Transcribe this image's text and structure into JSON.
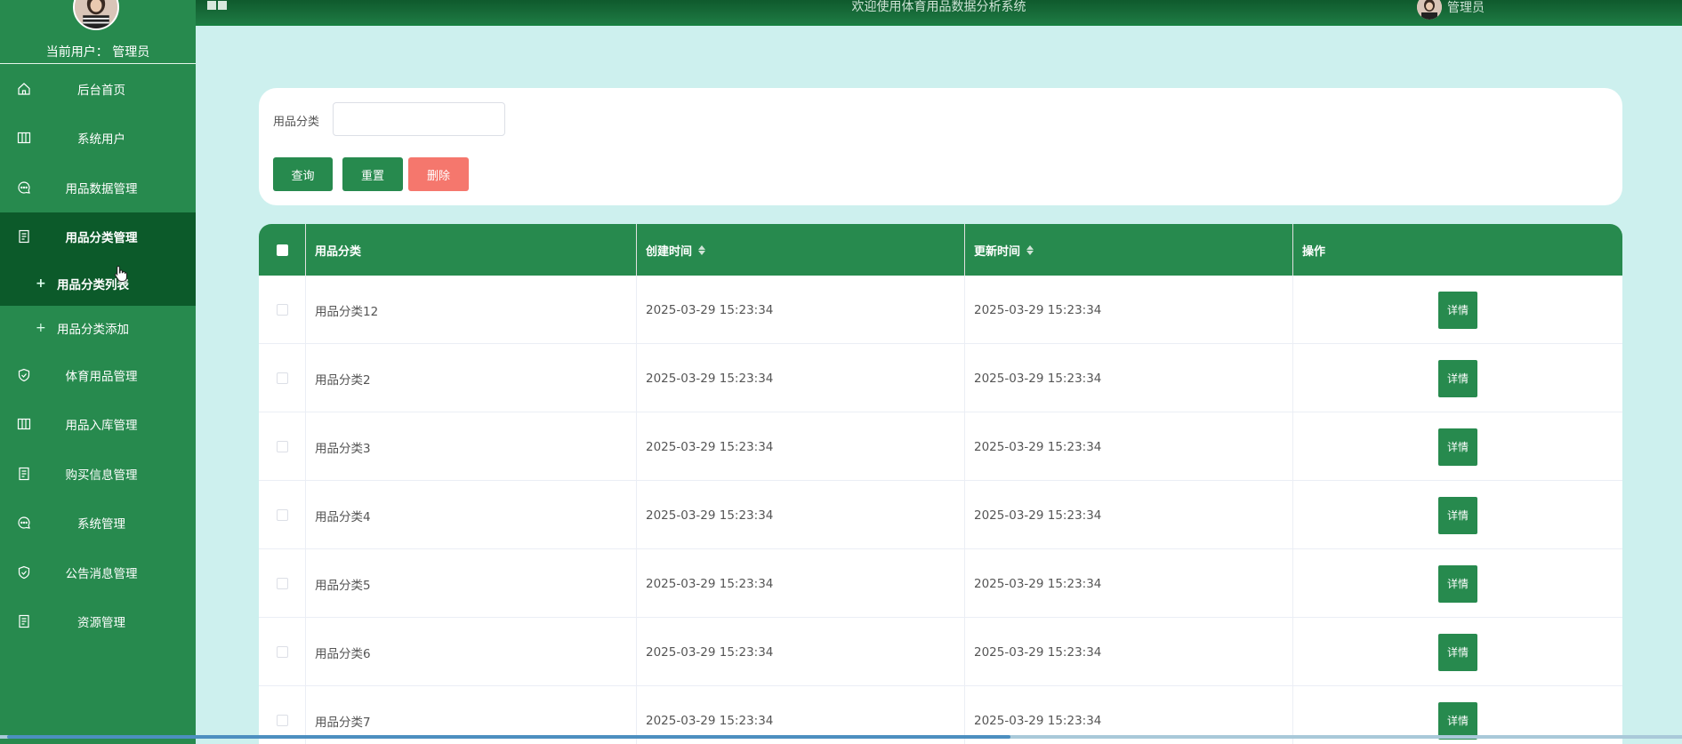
{
  "header": {
    "welcome": "欢迎使用体育用品数据分析系统",
    "username": "管理员"
  },
  "sidebar": {
    "current_user": "当前用户： 管理员",
    "items": [
      {
        "label": "后台首页",
        "icon": "home-icon"
      },
      {
        "label": "系统用户",
        "icon": "columns-icon"
      },
      {
        "label": "用品数据管理",
        "icon": "chat-icon"
      },
      {
        "label": "用品分类管理",
        "icon": "document-icon",
        "active": true,
        "children": [
          {
            "label": "用品分类列表",
            "active": true
          },
          {
            "label": "用品分类添加"
          }
        ]
      },
      {
        "label": "体育用品管理",
        "icon": "shield-icon"
      },
      {
        "label": "用品入库管理",
        "icon": "columns-icon"
      },
      {
        "label": "购买信息管理",
        "icon": "document-icon"
      },
      {
        "label": "系统管理",
        "icon": "chat-icon"
      },
      {
        "label": "公告消息管理",
        "icon": "shield-icon"
      },
      {
        "label": "资源管理",
        "icon": "document-icon"
      }
    ]
  },
  "search": {
    "label": "用品分类",
    "value": "",
    "placeholder": "",
    "query_label": "查询",
    "reset_label": "重置",
    "delete_label": "删除"
  },
  "table": {
    "columns": [
      "用品分类",
      "创建时间",
      "更新时间",
      "操作"
    ],
    "rows": [
      {
        "category": "用品分类12",
        "created": "2025-03-29 15:23:34",
        "updated": "2025-03-29 15:23:34",
        "action": "详情"
      },
      {
        "category": "用品分类2",
        "created": "2025-03-29 15:23:34",
        "updated": "2025-03-29 15:23:34",
        "action": "详情"
      },
      {
        "category": "用品分类3",
        "created": "2025-03-29 15:23:34",
        "updated": "2025-03-29 15:23:34",
        "action": "详情"
      },
      {
        "category": "用品分类4",
        "created": "2025-03-29 15:23:34",
        "updated": "2025-03-29 15:23:34",
        "action": "详情"
      },
      {
        "category": "用品分类5",
        "created": "2025-03-29 15:23:34",
        "updated": "2025-03-29 15:23:34",
        "action": "详情"
      },
      {
        "category": "用品分类6",
        "created": "2025-03-29 15:23:34",
        "updated": "2025-03-29 15:23:34",
        "action": "详情"
      },
      {
        "category": "用品分类7",
        "created": "2025-03-29 15:23:34",
        "updated": "2025-03-29 15:23:34",
        "action": "详情"
      }
    ]
  },
  "colors": {
    "primary": "#278a4e",
    "active_menu": "#0c5a2a",
    "danger": "#f5776d",
    "background": "#cdf0ee"
  }
}
